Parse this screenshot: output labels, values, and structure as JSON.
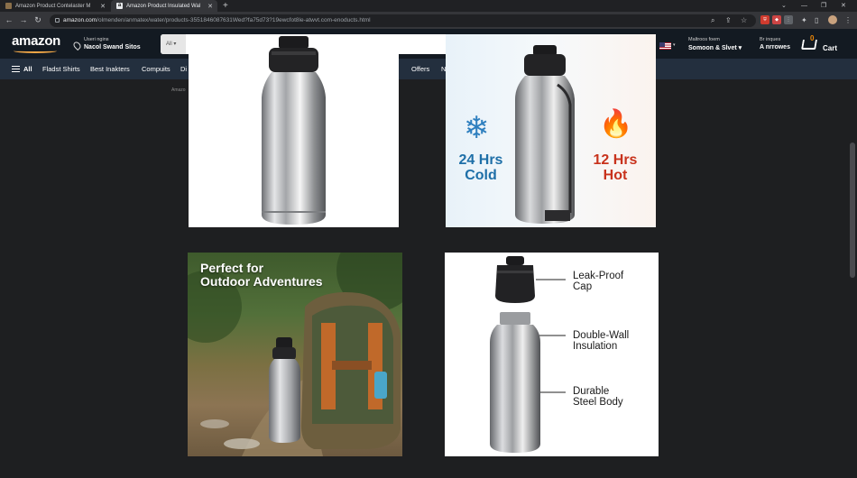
{
  "browser": {
    "tabs": [
      {
        "title": "Amazon Product Contelaster M",
        "active": false
      },
      {
        "title": "Amazon Product Insulated Wal",
        "active": true
      }
    ],
    "address": {
      "domain": "amazon.com",
      "path": "/olmenden/anmatex/water/products-3551846087631Wed?fa75d73?19ewcfot8le-atwvt.com-enoducts.html"
    }
  },
  "amazon_header": {
    "logo": "amazon",
    "deliver_to_line1": "Useri ngins",
    "deliver_to_line2": "Nacol Swand Sitos",
    "search_dept": "All",
    "account_line1": "Maltroos foem",
    "account_line2": "Somoon & Slvet",
    "returns_line1": "Br inques",
    "returns_line2": "A nrrowes",
    "cart_count": "0",
    "cart_label": "Cart"
  },
  "subnav": {
    "all_label": "All",
    "items": [
      "Fladst Shirts",
      "Best Inakters",
      "Compuits",
      "Di",
      "Offers",
      "N"
    ]
  },
  "breadcrumb": "Amazo",
  "images": {
    "img2": {
      "cold_hours": "24 Hrs",
      "cold_label": "Cold",
      "hot_hours": "12 Hrs",
      "hot_label": "Hot"
    },
    "img3": {
      "headline_line1": "Perfect for",
      "headline_line2": "Outdoor Adventures"
    },
    "img4": {
      "callout1_line1": "Leak-Proof",
      "callout1_line2": "Cap",
      "callout2_line1": "Double-Wall",
      "callout2_line2": "Insulation",
      "callout3_line1": "Durable",
      "callout3_line2": "Steel Body"
    }
  },
  "colors": {
    "page_bg": "#1e1f21",
    "amazon_header": "#131a22",
    "amazon_subnav": "#232f3e",
    "cold_blue": "#1e6fa8",
    "hot_red": "#c8321c"
  }
}
